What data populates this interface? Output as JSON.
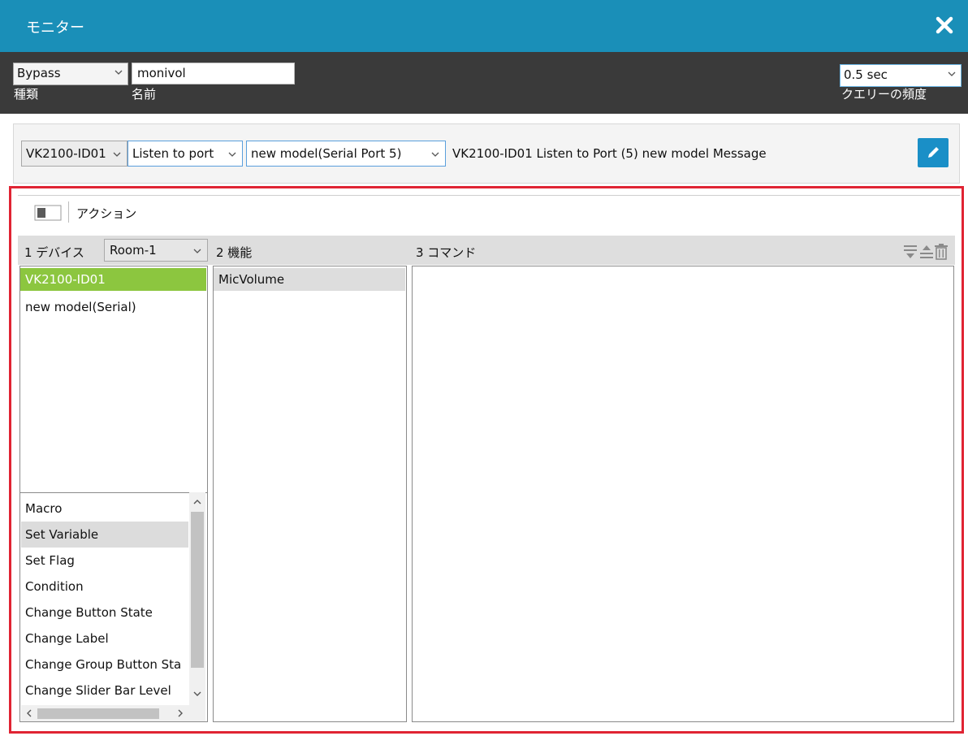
{
  "window": {
    "title": "モニター"
  },
  "colors": {
    "titlebar": "#1a8fb8",
    "accent_green": "#8cc63f",
    "edit_blue": "#1a8fc7",
    "highlight_red": "#e02433"
  },
  "topbar": {
    "type_value": "Bypass",
    "type_label": "種類",
    "name_value": "monivol",
    "name_label": "名前",
    "freq_value": "0.5 sec",
    "freq_label": "クエリーの頻度"
  },
  "message_row": {
    "device": "VK2100-ID01",
    "mode": "Listen to port",
    "port": "new model(Serial Port 5)",
    "description": "VK2100-ID01 Listen to Port (5) new model Message"
  },
  "action": {
    "label": "アクション"
  },
  "columns": {
    "devices_header": "1 デバイス",
    "room": "Room-1",
    "functions_header": "2 機能",
    "commands_header": "3 コマンド"
  },
  "devices": [
    "VK2100-ID01",
    "new model(Serial)"
  ],
  "functions": [
    "MicVolume"
  ],
  "actions": [
    "Macro",
    "Set Variable",
    "Set Flag",
    "Condition",
    "Change Button State",
    "Change Label",
    "Change Group Button Sta",
    "Change Slider Bar Level"
  ],
  "icons": [
    "close-icon",
    "chevron-down-icon",
    "edit-pencil-icon",
    "panel-toggle-icon",
    "move-down-icon",
    "move-up-icon",
    "delete-icon"
  ]
}
